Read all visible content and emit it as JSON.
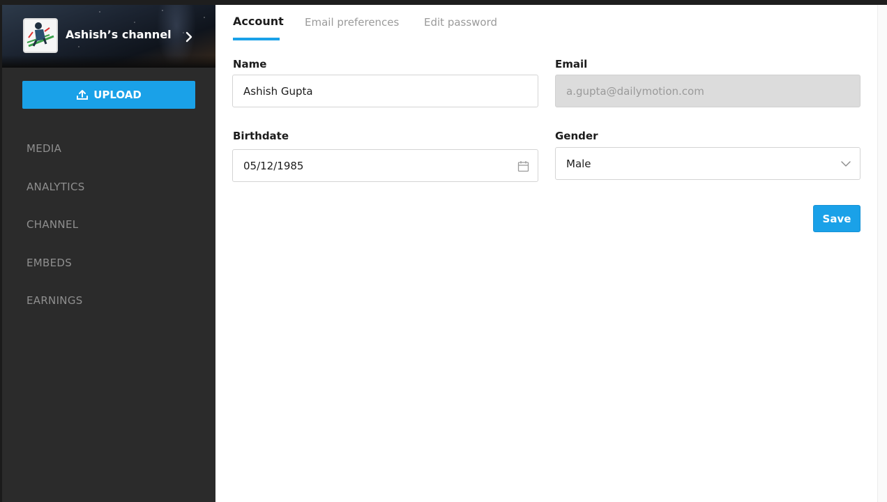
{
  "sidebar": {
    "channel_name": "Ashish’s channel",
    "upload_label": "UPLOAD",
    "nav_items": [
      {
        "label": "MEDIA"
      },
      {
        "label": "ANALYTICS"
      },
      {
        "label": "CHANNEL"
      },
      {
        "label": "EMBEDS"
      },
      {
        "label": "EARNINGS"
      }
    ]
  },
  "tabs": [
    {
      "label": "Account",
      "active": true
    },
    {
      "label": "Email preferences",
      "active": false
    },
    {
      "label": "Edit password",
      "active": false
    }
  ],
  "form": {
    "name": {
      "label": "Name",
      "value": "Ashish Gupta"
    },
    "email": {
      "label": "Email",
      "value": "a.gupta@dailymotion.com",
      "disabled": true
    },
    "birthdate": {
      "label": "Birthdate",
      "value": "05/12/1985",
      "icon": "calendar-icon"
    },
    "gender": {
      "label": "Gender",
      "value": "Male",
      "icon": "chevron-down-icon"
    },
    "save_label": "Save"
  },
  "colors": {
    "accent": "#1aa1e8",
    "sidebar_bg": "#2b2b2b",
    "nav_text": "#8f8f8f",
    "disabled_field": "#dcdcdc"
  }
}
